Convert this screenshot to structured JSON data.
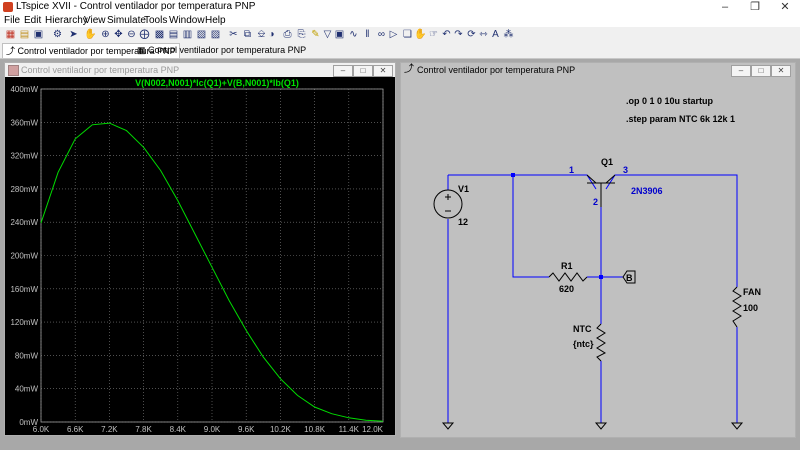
{
  "window": {
    "title": "LTspice XVII - Control ventilador por temperatura PNP"
  },
  "menu": [
    "File",
    "Edit",
    "Hierarchy",
    "View",
    "Simulate",
    "Tools",
    "Window",
    "Help"
  ],
  "tabs": [
    {
      "label": "Control ventilador por temperatura PNP",
      "active": true
    },
    {
      "label": "Control ventilador por temperatura PNP",
      "active": false
    }
  ],
  "plot_window": {
    "title": "Control ventilador por temperatura PNP"
  },
  "schematic_window": {
    "title": "Control ventilador por temperatura PNP"
  },
  "chart_data": {
    "type": "line",
    "title": "V(N002,N001)*Ic(Q1)+V(B,N001)*Ib(Q1)",
    "xlabel": "",
    "ylabel": "",
    "x_ticks": [
      "6.0K",
      "6.6K",
      "7.2K",
      "7.8K",
      "8.4K",
      "9.0K",
      "9.6K",
      "10.2K",
      "10.8K",
      "11.4K",
      "12.0K"
    ],
    "y_ticks": [
      "0mW",
      "40mW",
      "80mW",
      "120mW",
      "160mW",
      "200mW",
      "240mW",
      "280mW",
      "320mW",
      "360mW",
      "400mW"
    ],
    "xlim": [
      6000,
      12000
    ],
    "ylim": [
      0,
      400
    ],
    "grid": true,
    "series": [
      {
        "color": "#00dd00",
        "x": [
          6000,
          6300,
          6600,
          6900,
          7200,
          7500,
          7800,
          8100,
          8400,
          8700,
          9000,
          9300,
          9600,
          9900,
          10200,
          10500,
          10800,
          11100,
          11400,
          11700,
          12000
        ],
        "values": [
          239,
          300,
          340,
          357,
          359,
          350,
          330,
          302,
          266,
          226,
          186,
          146,
          110,
          78,
          52,
          32,
          18,
          10,
          5,
          2,
          1
        ]
      }
    ]
  },
  "schematic": {
    "directives": [
      ".op 0 1 0 10u startup",
      ".step param NTC 6k 12k 1"
    ],
    "v1": {
      "name": "V1",
      "value": "12"
    },
    "q1": {
      "name": "Q1",
      "model": "2N3906",
      "pin1": "1",
      "pin2": "2",
      "pin3": "3"
    },
    "r1": {
      "name": "R1",
      "value": "620"
    },
    "ntc": {
      "name": "NTC",
      "value": "{ntc}"
    },
    "fan": {
      "name": "FAN",
      "value": "100"
    },
    "label_b": "B"
  }
}
